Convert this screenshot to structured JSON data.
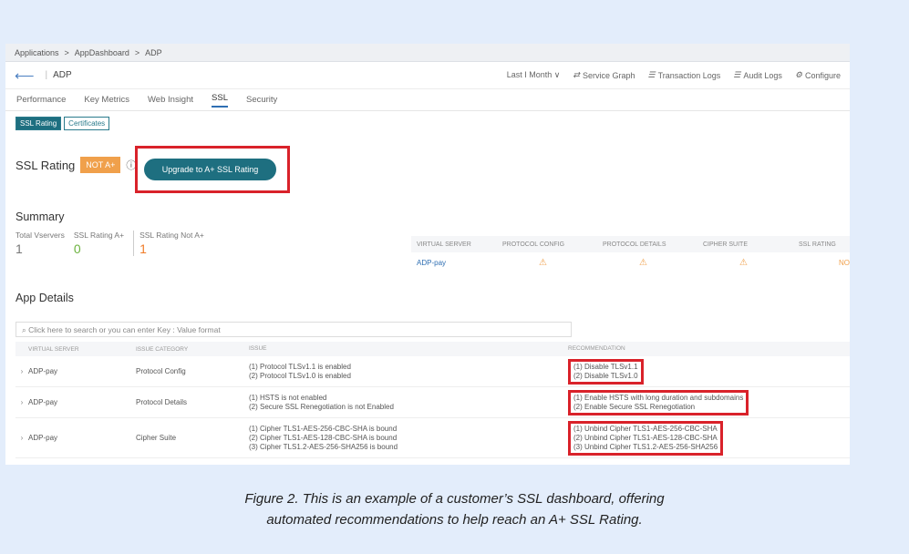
{
  "breadcrumb": [
    "Applications",
    ">",
    "AppDashboard",
    ">",
    "ADP"
  ],
  "header": {
    "back_icon": "arrow-left-icon",
    "app": "ADP",
    "toolbar": [
      {
        "label": "Last I Month ∨",
        "icon": ""
      },
      {
        "label": "Service Graph",
        "icon": "graph-icon"
      },
      {
        "label": "Transaction Logs",
        "icon": "log-icon"
      },
      {
        "label": "Audit Logs",
        "icon": "log-icon"
      },
      {
        "label": "Configure",
        "icon": "settings-icon"
      }
    ]
  },
  "tabs": [
    "Performance",
    "Key Metrics",
    "Web Insight",
    "SSL",
    "Security"
  ],
  "active_tab": "SSL",
  "subtabs": [
    "SSL Rating",
    "Certificates"
  ],
  "rating": {
    "title": "SSL Rating",
    "badge": "NOT A+",
    "info": "ⓘ",
    "upgrade": "Upgrade to A+ SSL Rating"
  },
  "summary": {
    "title": "Summary",
    "stats": [
      {
        "label": "Total Vservers",
        "value": "1"
      },
      {
        "label": "SSL Rating A+",
        "value": "0"
      },
      {
        "label": "SSL Rating Not A+",
        "value": "1"
      }
    ],
    "table": {
      "headers": [
        "VIRTUAL SERVER",
        "PROTOCOL CONFIG",
        "PROTOCOL DETAILS",
        "CIPHER SUITE",
        "SSL RATING"
      ],
      "rows": [
        [
          "ADP-pay",
          "⚠",
          "⚠",
          "⚠",
          "NO"
        ]
      ]
    }
  },
  "app_details": {
    "title": "App Details",
    "search_placeholder": "Click here to search or you can enter Key : Value format",
    "headers": [
      "VIRTUAL SERVER",
      "ISSUE CATEGORY",
      "ISSUE",
      "RECOMMENDATION"
    ],
    "rows": [
      {
        "vs": "ADP-pay",
        "category": "Protocol Config",
        "issue": [
          "(1) Protocol TLSv1.1 is enabled",
          "(2) Protocol TLSv1.0 is enabled"
        ],
        "rec": [
          "(1) Disable TLSv1.1",
          "(2) Disable TLSv1.0"
        ]
      },
      {
        "vs": "ADP-pay",
        "category": "Protocol Details",
        "issue": [
          "(1) HSTS is not enabled",
          "(2) Secure SSL Renegotiation is not Enabled"
        ],
        "rec": [
          "(1) Enable HSTS with long duration and subdomains",
          "(2) Enable Secure SSL Renegotiation"
        ]
      },
      {
        "vs": "ADP-pay",
        "category": "Cipher Suite",
        "issue": [
          "(1) Cipher TLS1-AES-256-CBC-SHA is bound",
          "(2) Cipher TLS1-AES-128-CBC-SHA is bound",
          "(3) Cipher TLS1.2-AES-256-SHA256 is bound"
        ],
        "rec": [
          "(1) Unbind Cipher TLS1-AES-256-CBC-SHA",
          "(2) Unbind Cipher TLS1-AES-128-CBC-SHA",
          "(3) Unbind Cipher TLS1.2-AES-256-SHA256"
        ]
      }
    ]
  },
  "caption": [
    "Figure 2. This is an example of a customer’s SSL dashboard, offering",
    "automated recommendations to help reach an A+ SSL Rating."
  ]
}
